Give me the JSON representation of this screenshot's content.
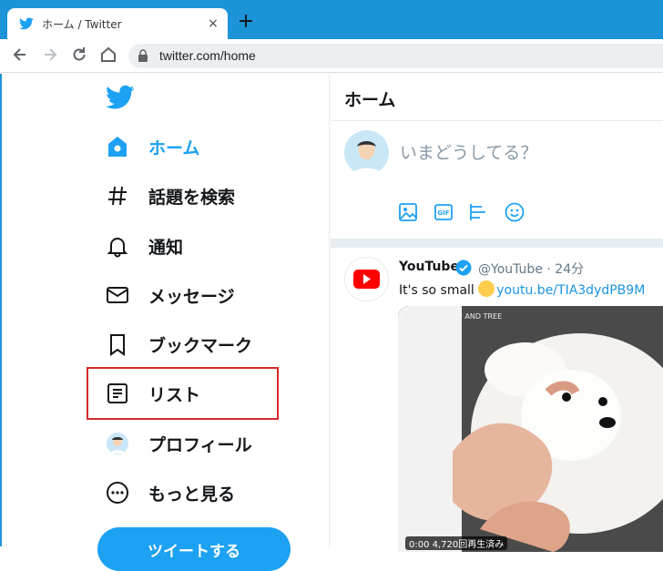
{
  "browser": {
    "tab_title": "ホーム / Twitter",
    "tab_close": "×",
    "new_tab": "+",
    "url": "twitter.com/home"
  },
  "sidebar": {
    "items": [
      {
        "label": "ホーム",
        "icon": "home-icon",
        "active": true
      },
      {
        "label": "話題を検索",
        "icon": "hashtag-icon"
      },
      {
        "label": "通知",
        "icon": "bell-icon"
      },
      {
        "label": "メッセージ",
        "icon": "envelope-icon"
      },
      {
        "label": "ブックマーク",
        "icon": "bookmark-icon"
      },
      {
        "label": "リスト",
        "icon": "list-icon"
      },
      {
        "label": "プロフィール",
        "icon": "avatar-icon"
      },
      {
        "label": "もっと見る",
        "icon": "more-icon"
      }
    ],
    "tweet_button": "ツイートする"
  },
  "main": {
    "title": "ホーム",
    "compose_placeholder": "いまどうしてる？",
    "tools": [
      "image-icon",
      "gif-icon",
      "poll-icon",
      "emoji-icon"
    ]
  },
  "tweet": {
    "name": "YouTube",
    "handle": "@YouTube · 24分",
    "text": "It's so small ",
    "link": "youtu.be/TIA3dydPB9M",
    "media_caption": "▶ 슈앤트리 | SHU AND TREE",
    "media_time": "0:00  4,720回再生済み"
  },
  "colors": {
    "accent": "#1da1f2",
    "browser_bar": "#1d93d8",
    "highlight": "#d42a2a"
  }
}
